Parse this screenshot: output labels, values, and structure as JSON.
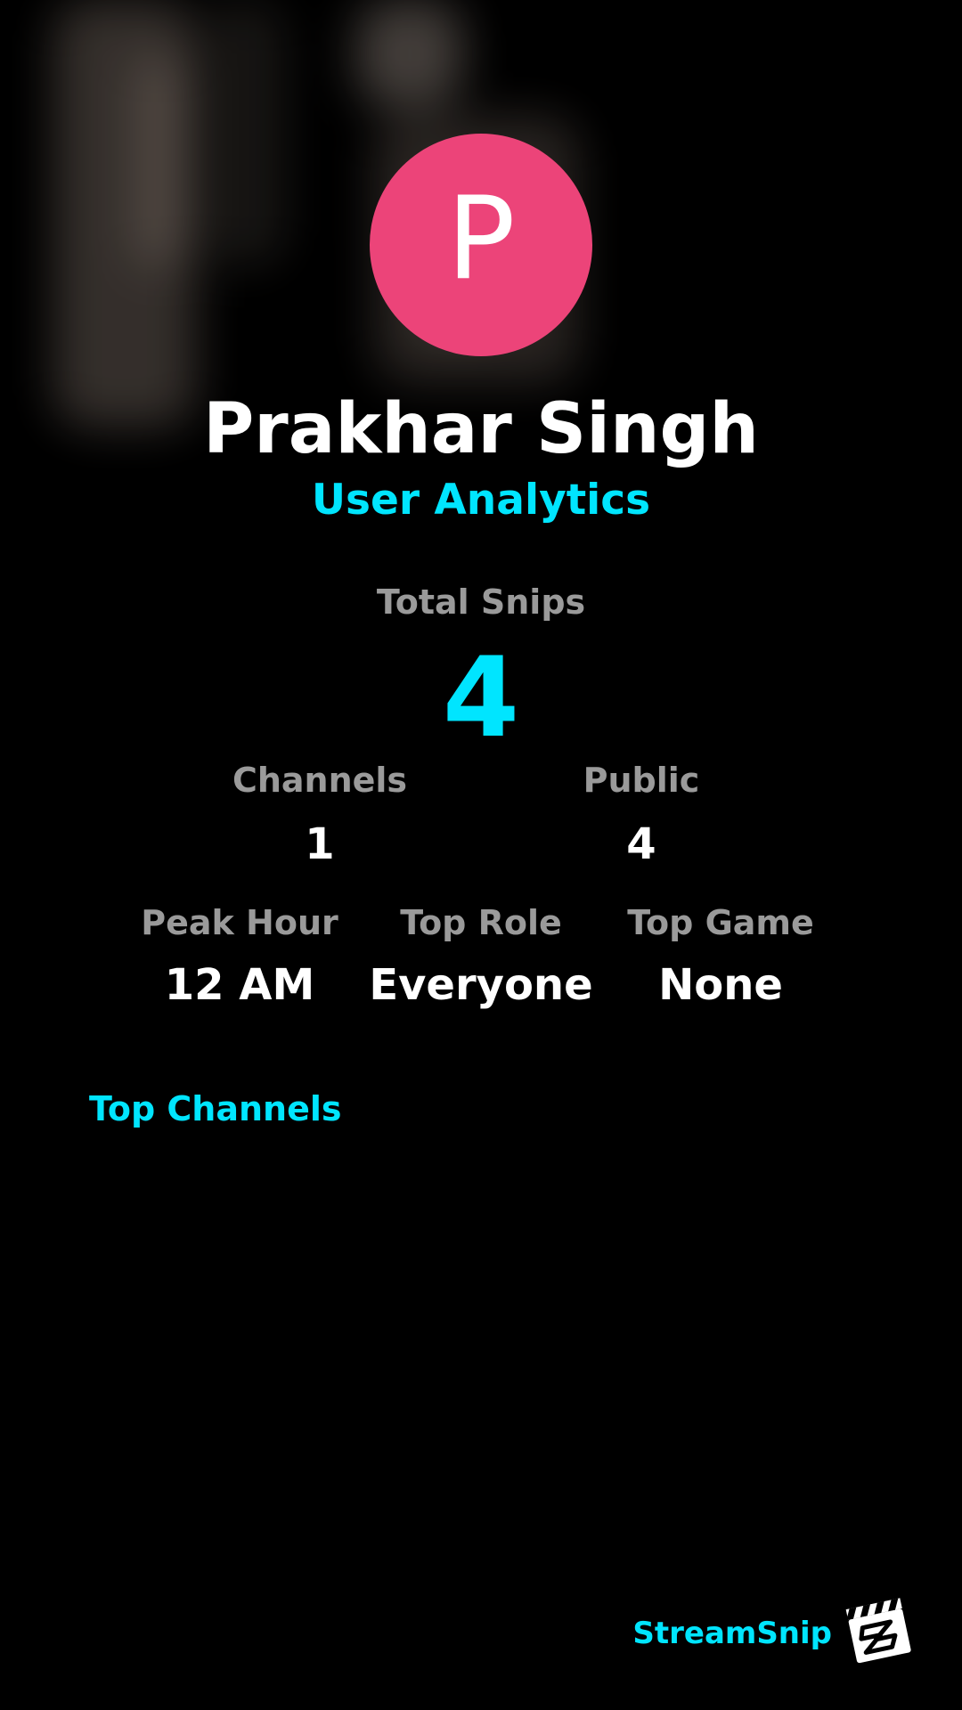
{
  "profile": {
    "avatar_letter": "P",
    "avatar_color": "#ec4479",
    "name": "Prakhar Singh",
    "subtitle": "User Analytics"
  },
  "stats": {
    "total_snips_label": "Total Snips",
    "total_snips_value": "4",
    "channels_label": "Channels",
    "channels_value": "1",
    "public_label": "Public",
    "public_value": "4",
    "peak_hour_label": "Peak Hour",
    "peak_hour_value": "12 AM",
    "top_role_label": "Top Role",
    "top_role_value": "Everyone",
    "top_game_label": "Top Game",
    "top_game_value": "None"
  },
  "sections": {
    "top_channels_title": "Top Channels"
  },
  "branding": {
    "name": "StreamSnip",
    "logo_icon": "clapperboard-icon"
  },
  "colors": {
    "accent": "#00e5ff",
    "label_gray": "#9a9a9a",
    "background": "#000000"
  }
}
